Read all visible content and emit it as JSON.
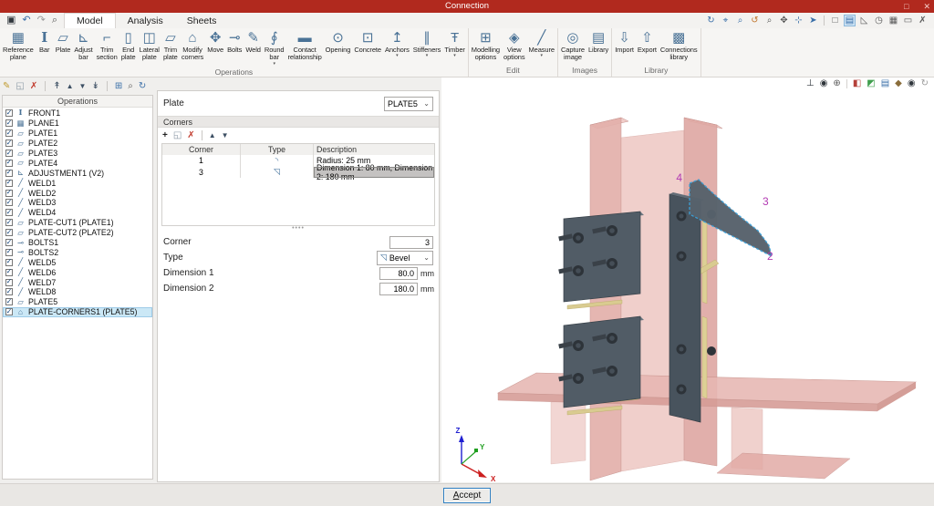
{
  "window": {
    "title": "Connection",
    "controls": [
      {
        "name": "restore",
        "glyph": "□"
      },
      {
        "name": "close",
        "glyph": "✕"
      }
    ]
  },
  "quick_access": [
    {
      "name": "save",
      "glyph": "▣"
    },
    {
      "name": "undo",
      "glyph": "↶"
    },
    {
      "name": "redo",
      "glyph": "↷"
    },
    {
      "name": "search",
      "glyph": "⌕"
    }
  ],
  "tabs": [
    {
      "label": "Model",
      "active": true
    },
    {
      "label": "Analysis",
      "active": false
    },
    {
      "label": "Sheets",
      "active": false
    }
  ],
  "view_toolbar": [
    {
      "name": "rotate-view",
      "glyph": "↻"
    },
    {
      "name": "zoom-extents",
      "glyph": "⌖"
    },
    {
      "name": "zoom-window",
      "glyph": "⌕"
    },
    {
      "name": "refresh-view",
      "glyph": "↺"
    },
    {
      "name": "magnifier",
      "glyph": "⌕"
    },
    {
      "name": "pan",
      "glyph": "✥"
    },
    {
      "name": "move-view",
      "glyph": "⊹"
    },
    {
      "name": "select-arrow",
      "glyph": "➤"
    },
    {
      "name": "wireframe",
      "glyph": "□"
    },
    {
      "name": "workplane",
      "glyph": "▤",
      "selected": true
    },
    {
      "name": "angle",
      "glyph": "◺"
    },
    {
      "name": "clock",
      "glyph": "◷"
    },
    {
      "name": "grid",
      "glyph": "▦"
    },
    {
      "name": "comment",
      "glyph": "▭"
    },
    {
      "name": "cut",
      "glyph": "✗"
    }
  ],
  "ribbon": {
    "groups": [
      {
        "label": "Operations",
        "buttons": [
          {
            "label": "Reference plane",
            "icon": "▦"
          },
          {
            "label": "Bar",
            "icon": "I"
          },
          {
            "label": "Plate",
            "icon": "▱"
          },
          {
            "label": "Adjust bar",
            "icon": "⊾"
          },
          {
            "label": "Trim section",
            "icon": "⌐"
          },
          {
            "label": "End plate",
            "icon": "▯"
          },
          {
            "label": "Lateral plate",
            "icon": "◫"
          },
          {
            "label": "Trim plate",
            "icon": "▱"
          },
          {
            "label": "Modify corners",
            "icon": "⌂"
          },
          {
            "label": "Move",
            "icon": "✥"
          },
          {
            "label": "Bolts",
            "icon": "⊸"
          },
          {
            "label": "Weld",
            "icon": "✎"
          },
          {
            "label": "Round bar",
            "icon": "∮",
            "dropdown": true
          },
          {
            "label": "Contact relationship",
            "icon": "▬"
          },
          {
            "label": "Opening",
            "icon": "⊙"
          },
          {
            "label": "Concrete",
            "icon": "⊡"
          },
          {
            "label": "Anchors",
            "icon": "↥",
            "dropdown": true
          },
          {
            "label": "Stiffeners",
            "icon": "∥",
            "dropdown": true
          },
          {
            "label": "Timber",
            "icon": "Ŧ",
            "dropdown": true
          }
        ]
      },
      {
        "label": "Edit",
        "buttons": [
          {
            "label": "Modelling options",
            "icon": "⊞"
          },
          {
            "label": "View options",
            "icon": "◈"
          },
          {
            "label": "Measure",
            "icon": "╱",
            "dropdown": true
          }
        ]
      },
      {
        "label": "Images",
        "buttons": [
          {
            "label": "Capture image",
            "icon": "◎"
          },
          {
            "label": "Library",
            "icon": "▤"
          }
        ]
      },
      {
        "label": "Library",
        "buttons": [
          {
            "label": "Import",
            "icon": "⇩"
          },
          {
            "label": "Export",
            "icon": "⇧"
          },
          {
            "label": "Connections library",
            "icon": "▩"
          }
        ]
      }
    ]
  },
  "left_toolbar": [
    {
      "name": "edit",
      "glyph": "✎"
    },
    {
      "name": "copy",
      "glyph": "◱"
    },
    {
      "name": "delete",
      "glyph": "✗"
    },
    {
      "name": "move-top",
      "glyph": "↟"
    },
    {
      "name": "move-up",
      "glyph": "▲"
    },
    {
      "name": "move-down",
      "glyph": "▼"
    },
    {
      "name": "move-bottom",
      "glyph": "↡"
    },
    {
      "name": "group",
      "glyph": "⊞"
    },
    {
      "name": "find",
      "glyph": "⌕"
    },
    {
      "name": "refresh",
      "glyph": "↻"
    }
  ],
  "operations_panel": {
    "title": "Operations",
    "items": [
      {
        "label": "FRONT1",
        "icon": "I",
        "checked": true,
        "selected": false
      },
      {
        "label": "PLANE1",
        "icon": "▦",
        "checked": true,
        "selected": false
      },
      {
        "label": "PLATE1",
        "icon": "▱",
        "checked": true,
        "selected": false
      },
      {
        "label": "PLATE2",
        "icon": "▱",
        "checked": true,
        "selected": false
      },
      {
        "label": "PLATE3",
        "icon": "▱",
        "checked": true,
        "selected": false
      },
      {
        "label": "PLATE4",
        "icon": "▱",
        "checked": true,
        "selected": false
      },
      {
        "label": "ADJUSTMENT1 (V2)",
        "icon": "⊾",
        "checked": true,
        "selected": false
      },
      {
        "label": "WELD1",
        "icon": "╱",
        "checked": true,
        "selected": false
      },
      {
        "label": "WELD2",
        "icon": "╱",
        "checked": true,
        "selected": false
      },
      {
        "label": "WELD3",
        "icon": "╱",
        "checked": true,
        "selected": false
      },
      {
        "label": "WELD4",
        "icon": "╱",
        "checked": true,
        "selected": false
      },
      {
        "label": "PLATE-CUT1 (PLATE1)",
        "icon": "▱",
        "checked": true,
        "selected": false
      },
      {
        "label": "PLATE-CUT2 (PLATE2)",
        "icon": "▱",
        "checked": true,
        "selected": false
      },
      {
        "label": "BOLTS1",
        "icon": "⊸",
        "checked": true,
        "selected": false
      },
      {
        "label": "BOLTS2",
        "icon": "⊸",
        "checked": true,
        "selected": false
      },
      {
        "label": "WELD5",
        "icon": "╱",
        "checked": true,
        "selected": false
      },
      {
        "label": "WELD6",
        "icon": "╱",
        "checked": true,
        "selected": false
      },
      {
        "label": "WELD7",
        "icon": "╱",
        "checked": true,
        "selected": false
      },
      {
        "label": "WELD8",
        "icon": "╱",
        "checked": true,
        "selected": false
      },
      {
        "label": "PLATE5",
        "icon": "▱",
        "checked": true,
        "selected": false
      },
      {
        "label": "PLATE-CORNERS1 (PLATE5)",
        "icon": "⌂",
        "checked": true,
        "selected": true
      }
    ]
  },
  "properties": {
    "plate_label": "Plate",
    "plate_value": "PLATE5",
    "corners": {
      "title": "Corners",
      "toolbar": [
        {
          "name": "add",
          "glyph": "+"
        },
        {
          "name": "copy",
          "glyph": "◱"
        },
        {
          "name": "delete",
          "glyph": "✗"
        },
        {
          "name": "row-up",
          "glyph": "▲"
        },
        {
          "name": "row-down",
          "glyph": "▼"
        }
      ],
      "table": {
        "headers": [
          "Corner",
          "Type",
          "Description"
        ],
        "rows": [
          {
            "corner": "1",
            "type_icon": "◝",
            "description": "Radius: 25 mm",
            "selected": false
          },
          {
            "corner": "3",
            "type_icon": "◹",
            "description": "Dimension 1: 80 mm, Dimension 2: 180 mm",
            "selected": true
          }
        ]
      }
    },
    "fields": {
      "corner": {
        "label": "Corner",
        "value": "3"
      },
      "type": {
        "label": "Type",
        "value": "Bevel",
        "icon": "◹"
      },
      "dim1": {
        "label": "Dimension 1",
        "value": "80.0",
        "unit": "mm"
      },
      "dim2": {
        "label": "Dimension 2",
        "value": "180.0",
        "unit": "mm"
      }
    }
  },
  "viewport": {
    "toolbar": [
      {
        "name": "axes",
        "glyph": "⊥"
      },
      {
        "name": "orbit",
        "glyph": "◉"
      },
      {
        "name": "gimbal",
        "glyph": "⊕"
      },
      {
        "name": "solid-view",
        "glyph": "◧"
      },
      {
        "name": "transparent-view",
        "glyph": "◩"
      },
      {
        "name": "layers-view",
        "glyph": "▤"
      },
      {
        "name": "materials-view",
        "glyph": "◆"
      },
      {
        "name": "visibility",
        "glyph": "◉"
      },
      {
        "name": "rotate-model",
        "glyph": "↻"
      }
    ],
    "corner_labels": [
      {
        "text": "4"
      },
      {
        "text": "3"
      },
      {
        "text": "2"
      }
    ],
    "axes": {
      "x": "X",
      "y": "Y",
      "z": "Z"
    }
  },
  "footer": {
    "accept_label": "Accept"
  },
  "colors": {
    "titlebar": "#b1291e",
    "selection": "#cbe8f6",
    "accent_blue": "#2f7fc1",
    "steel_plate": "#515c66",
    "member_pink": "#e3b0ab",
    "weld_yellow": "#d9cb90",
    "highlight_outline": "#3ba0d8",
    "corner_label_magenta": "#b23ab2"
  }
}
